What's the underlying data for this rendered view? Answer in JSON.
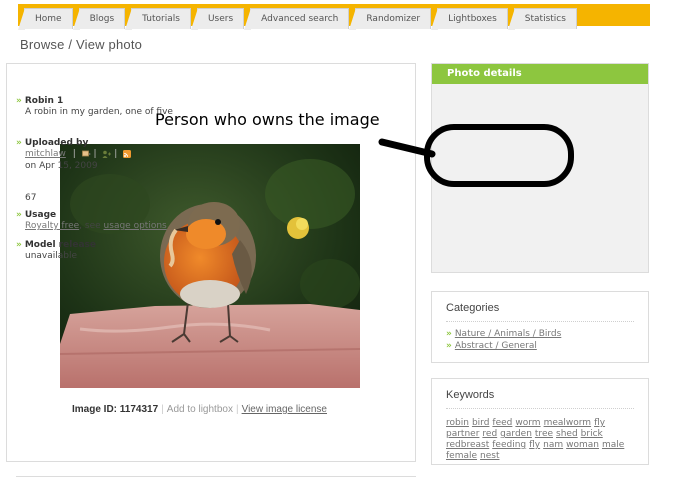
{
  "tabs": [
    "Home",
    "Blogs",
    "Tutorials",
    "Users",
    "Advanced search",
    "Randomizer",
    "Lightboxes",
    "Statistics"
  ],
  "page_title": "Browse / View photo",
  "annotation": "Person who owns the image",
  "image_meta": {
    "id_label": "Image ID:",
    "id_value": "1174317",
    "add_lightbox": "Add to lightbox",
    "view_license": "View image license"
  },
  "details": {
    "header": "Photo details",
    "title": "Robin 1",
    "description": "A robin in my garden, one of five",
    "uploaded_label": "Uploaded by",
    "uploader": "mitchlaw",
    "uploaded_on": "on Apr 15, 2009",
    "views": "67",
    "usage_label": "Usage",
    "usage_link": "Royalty free",
    "usage_see": ", see",
    "usage_options": "usage options",
    "release_label": "Model release",
    "release_value": "unavailable"
  },
  "categories": {
    "title": "Categories",
    "items": [
      "Nature / Animals / Birds",
      "Abstract / General"
    ]
  },
  "keywords": {
    "title": "Keywords",
    "items": [
      "robin",
      "bird",
      "feed",
      "worm",
      "mealworm",
      "fly",
      "partner",
      "red",
      "garden",
      "tree",
      "shed",
      "brick",
      "redbreast",
      "feeding",
      "fly",
      "nam",
      "woman",
      "male",
      "female",
      "nest"
    ]
  },
  "colors": {
    "tab_bar": "#f5b400",
    "panel_header": "#8dc63f",
    "link": "#777777"
  }
}
